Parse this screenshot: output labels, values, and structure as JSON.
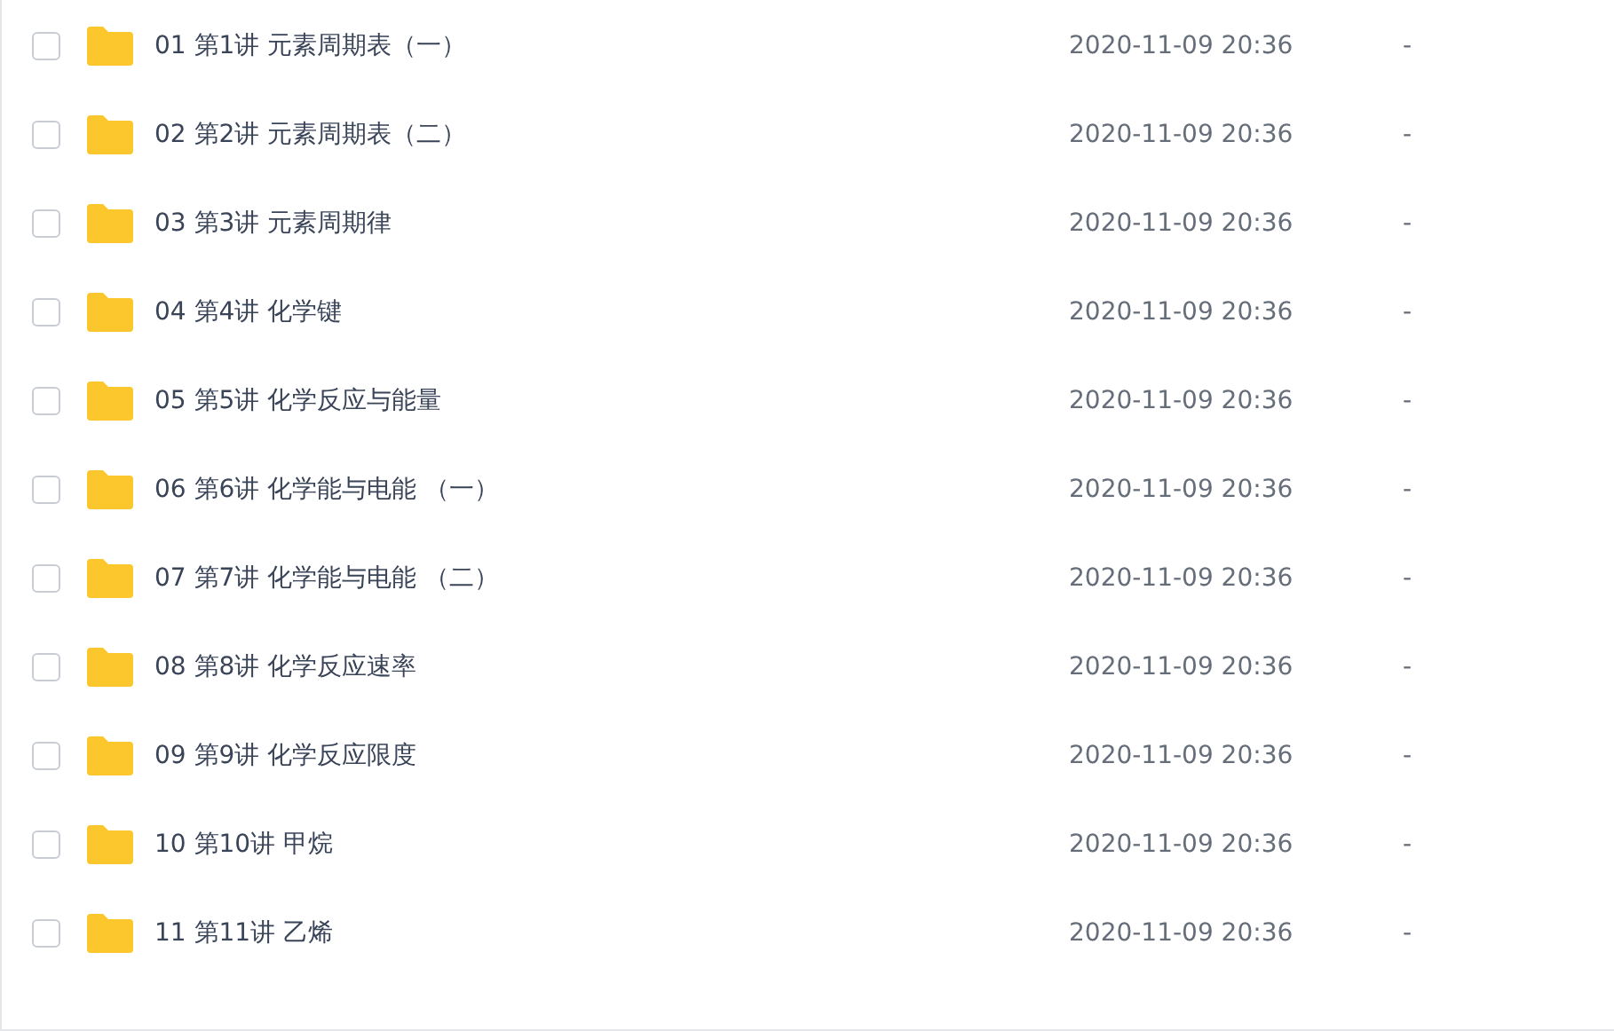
{
  "files": [
    {
      "name": "01 第1讲 元素周期表（一）",
      "modified": "2020-11-09 20:36",
      "size": "-",
      "checked": false
    },
    {
      "name": "02 第2讲 元素周期表（二）",
      "modified": "2020-11-09 20:36",
      "size": "-",
      "checked": false
    },
    {
      "name": "03 第3讲 元素周期律",
      "modified": "2020-11-09 20:36",
      "size": "-",
      "checked": false
    },
    {
      "name": "04 第4讲 化学键",
      "modified": "2020-11-09 20:36",
      "size": "-",
      "checked": false
    },
    {
      "name": "05 第5讲 化学反应与能量",
      "modified": "2020-11-09 20:36",
      "size": "-",
      "checked": false
    },
    {
      "name": "06 第6讲 化学能与电能 （一）",
      "modified": "2020-11-09 20:36",
      "size": "-",
      "checked": false
    },
    {
      "name": "07 第7讲 化学能与电能 （二）",
      "modified": "2020-11-09 20:36",
      "size": "-",
      "checked": false
    },
    {
      "name": "08 第8讲 化学反应速率",
      "modified": "2020-11-09 20:36",
      "size": "-",
      "checked": false
    },
    {
      "name": "09 第9讲 化学反应限度",
      "modified": "2020-11-09 20:36",
      "size": "-",
      "checked": false
    },
    {
      "name": "10 第10讲 甲烷",
      "modified": "2020-11-09 20:36",
      "size": "-",
      "checked": false
    },
    {
      "name": "11 第11讲 乙烯",
      "modified": "2020-11-09 20:36",
      "size": "-",
      "checked": false
    }
  ]
}
